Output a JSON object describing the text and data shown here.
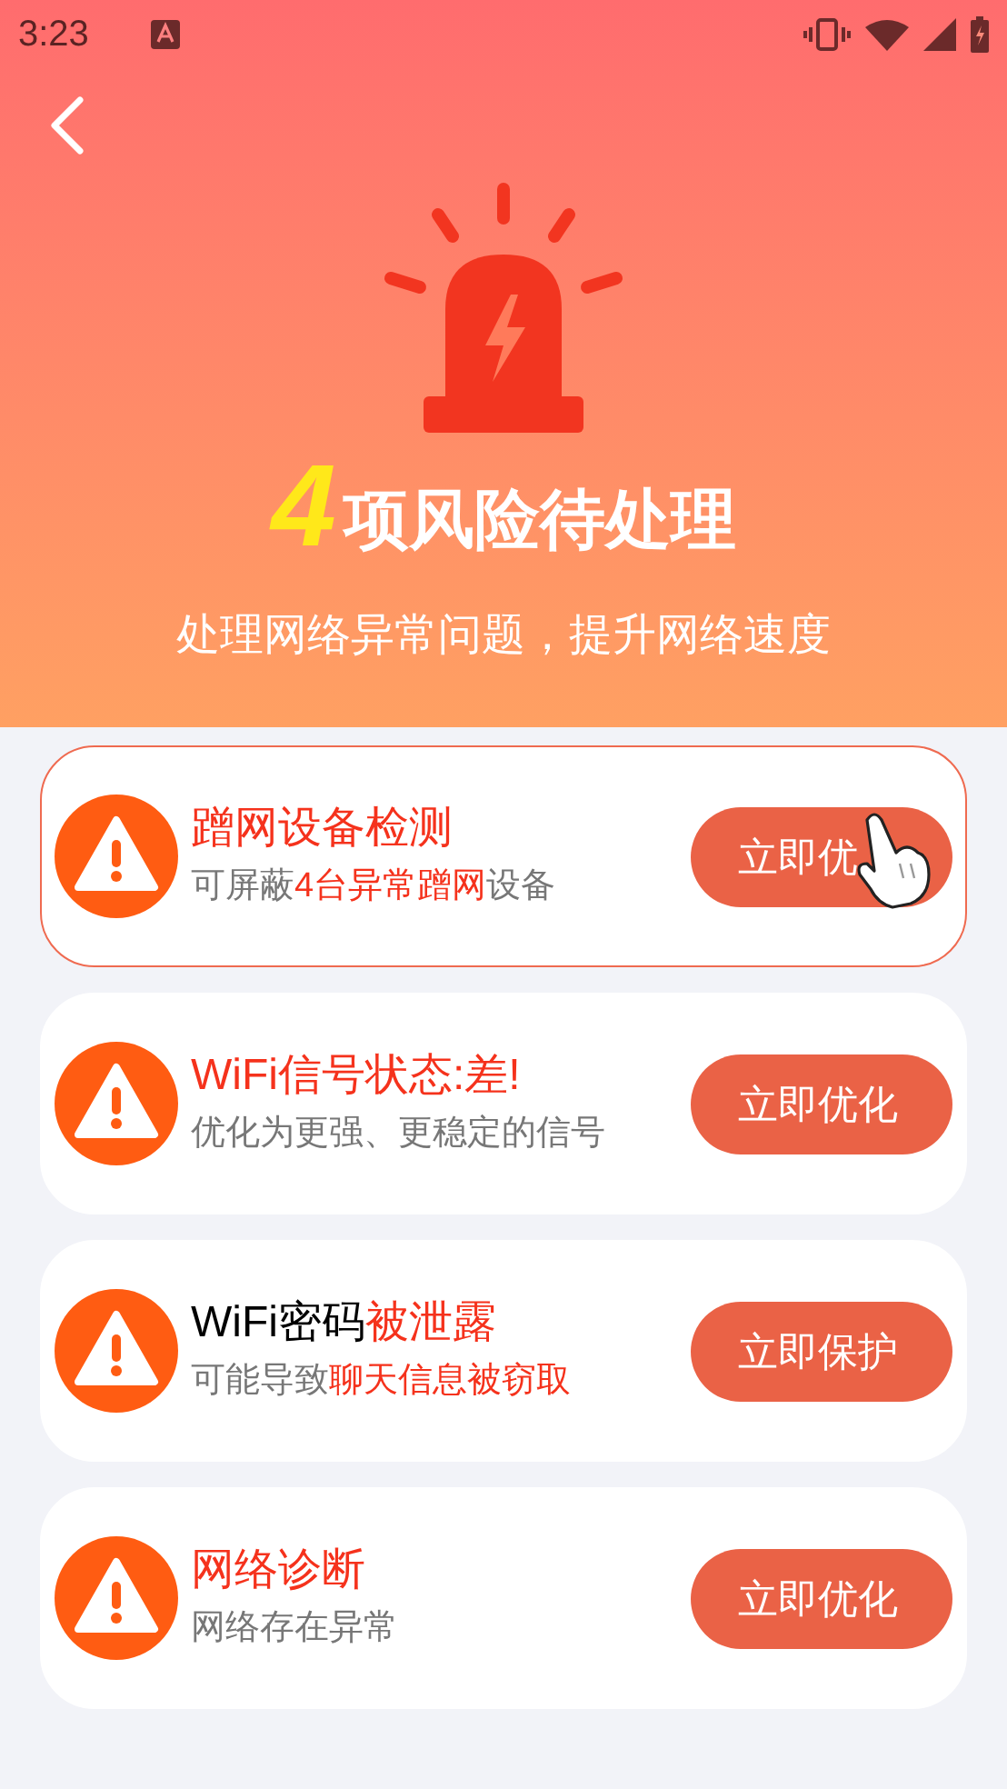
{
  "status_bar": {
    "time": "3:23"
  },
  "header": {
    "count": "4",
    "title": "项风险待处理",
    "subtitle": "处理网络异常问题，提升网络速度"
  },
  "items": [
    {
      "selected": true,
      "title": [
        {
          "text": "蹭网设备检测",
          "highlight": true
        }
      ],
      "desc": [
        {
          "text": "可屏蔽",
          "highlight": false
        },
        {
          "text": "4台异常蹭网",
          "highlight": true
        },
        {
          "text": "设备",
          "highlight": false
        }
      ],
      "button": "立即优",
      "pointer": true
    },
    {
      "selected": false,
      "title": [
        {
          "text": "WiFi信号状态:差!",
          "highlight": true
        }
      ],
      "desc": [
        {
          "text": "优化为更强、更稳定的信号",
          "highlight": false
        }
      ],
      "button": "立即优化",
      "pointer": false
    },
    {
      "selected": false,
      "title": [
        {
          "text": "WiFi密码",
          "highlight": false
        },
        {
          "text": "被泄露",
          "highlight": true
        }
      ],
      "desc": [
        {
          "text": "可能导致",
          "highlight": false
        },
        {
          "text": "聊天信息被窃取",
          "highlight": true
        }
      ],
      "button": "立即保护",
      "pointer": false
    },
    {
      "selected": false,
      "title": [
        {
          "text": "网络诊断",
          "highlight": true
        }
      ],
      "desc": [
        {
          "text": "网络存在异常",
          "highlight": false
        }
      ],
      "button": "立即优化",
      "pointer": false
    }
  ]
}
